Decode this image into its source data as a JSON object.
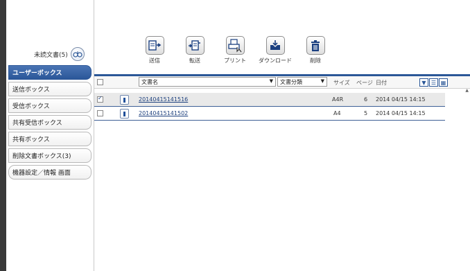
{
  "sidebar": {
    "unread_label": "未読文書(5)",
    "items": [
      {
        "label": "ユーザーボックス",
        "active": true
      },
      {
        "label": "送信ボックス",
        "active": false
      },
      {
        "label": "受信ボックス",
        "active": false
      },
      {
        "label": "共有受信ボックス",
        "active": false
      },
      {
        "label": "共有ボックス",
        "active": false
      },
      {
        "label": "削除文書ボックス(3)",
        "active": false
      },
      {
        "label": "機器設定／情報 画面",
        "active": false
      }
    ]
  },
  "toolbar": {
    "send_label": "送信",
    "forward_label": "転送",
    "print_label": "プリント",
    "download_label": "ダウンロード",
    "delete_label": "削除"
  },
  "table": {
    "name_select": "文書名",
    "category_select": "文書分類",
    "size_header": "サイズ",
    "pages_header": "ページ",
    "date_header": "日付",
    "rows": [
      {
        "name": "20140415141516",
        "size": "A4R",
        "pages": "6",
        "date": "2014 04/15 14:15",
        "checked": true
      },
      {
        "name": "20140415141502",
        "size": "A4",
        "pages": "5",
        "date": "2014 04/15 14:15",
        "checked": false
      }
    ]
  },
  "colors": {
    "accent": "#2b5797",
    "active_tab": "#3a66a8",
    "selected_row": "#e9e9e9"
  }
}
